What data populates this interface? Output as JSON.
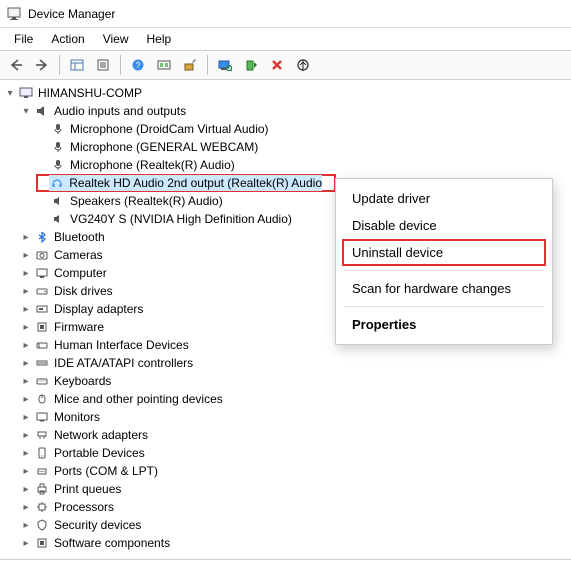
{
  "window": {
    "title": "Device Manager"
  },
  "menubar": {
    "file": "File",
    "action": "Action",
    "view": "View",
    "help": "Help"
  },
  "tree": {
    "root": "HIMANSHU-COMP",
    "audio": "Audio inputs and outputs",
    "audio_children": [
      "Microphone (DroidCam Virtual Audio)",
      "Microphone (GENERAL WEBCAM)",
      "Microphone (Realtek(R) Audio)",
      "Realtek HD Audio 2nd output (Realtek(R) Audio",
      "Speakers (Realtek(R) Audio)",
      "VG240Y S (NVIDIA High Definition Audio)"
    ],
    "collapsed": [
      "Bluetooth",
      "Cameras",
      "Computer",
      "Disk drives",
      "Display adapters",
      "Firmware",
      "Human Interface Devices",
      "IDE ATA/ATAPI controllers",
      "Keyboards",
      "Mice and other pointing devices",
      "Monitors",
      "Network adapters",
      "Portable Devices",
      "Ports (COM & LPT)",
      "Print queues",
      "Processors",
      "Security devices",
      "Software components"
    ]
  },
  "context_menu": {
    "update": "Update driver",
    "disable": "Disable device",
    "uninstall": "Uninstall device",
    "scan": "Scan for hardware changes",
    "properties": "Properties"
  }
}
